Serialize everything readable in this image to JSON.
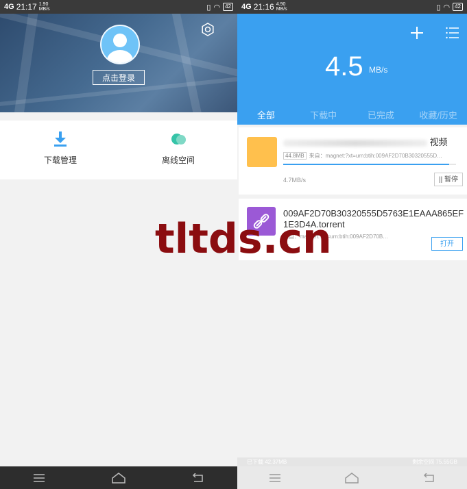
{
  "left": {
    "status": {
      "time": "21:17",
      "speed_top": "1.90",
      "speed_unit": "MB/s",
      "signal": "4G",
      "battery": "42"
    },
    "header": {
      "login_label": "点击登录",
      "settings_icon": "gear-icon"
    },
    "menu": [
      {
        "label": "下载管理",
        "icon": "download-icon"
      },
      {
        "label": "离线空间",
        "icon": "cloud-icon"
      }
    ]
  },
  "right": {
    "status": {
      "time": "21:16",
      "speed_top": "4.90",
      "speed_unit": "MB/s",
      "signal": "4G",
      "battery": "42"
    },
    "speed": {
      "value": "4.5",
      "unit": "MB/s"
    },
    "tabs": [
      "全部",
      "下载中",
      "已完成",
      "收藏/历史"
    ],
    "tasks": [
      {
        "title_suffix": "视频",
        "size": "44.8MB",
        "source": "来自：magnet:?xt=urn:btih:009AF2D70B30320555D…",
        "progress": 0.96,
        "rate": "4.7MB/s",
        "action": "|| 暂停"
      },
      {
        "title": "009AF2D70B30320555D5763E1EAAA865EF1E3D4A.torrent",
        "source": "来自：magnet:?xt=urn:btih:009AF2D70B…",
        "status_prefix": "开",
        "action": "打开"
      }
    ],
    "storage": {
      "downloaded": "已下载 42.37MB",
      "free": "剩余空间 75.55GB"
    }
  },
  "watermark": "tltds.cn",
  "colors": {
    "accent": "#3aa0f0",
    "folder": "#ffc04d",
    "torrent": "#9b59d6"
  }
}
